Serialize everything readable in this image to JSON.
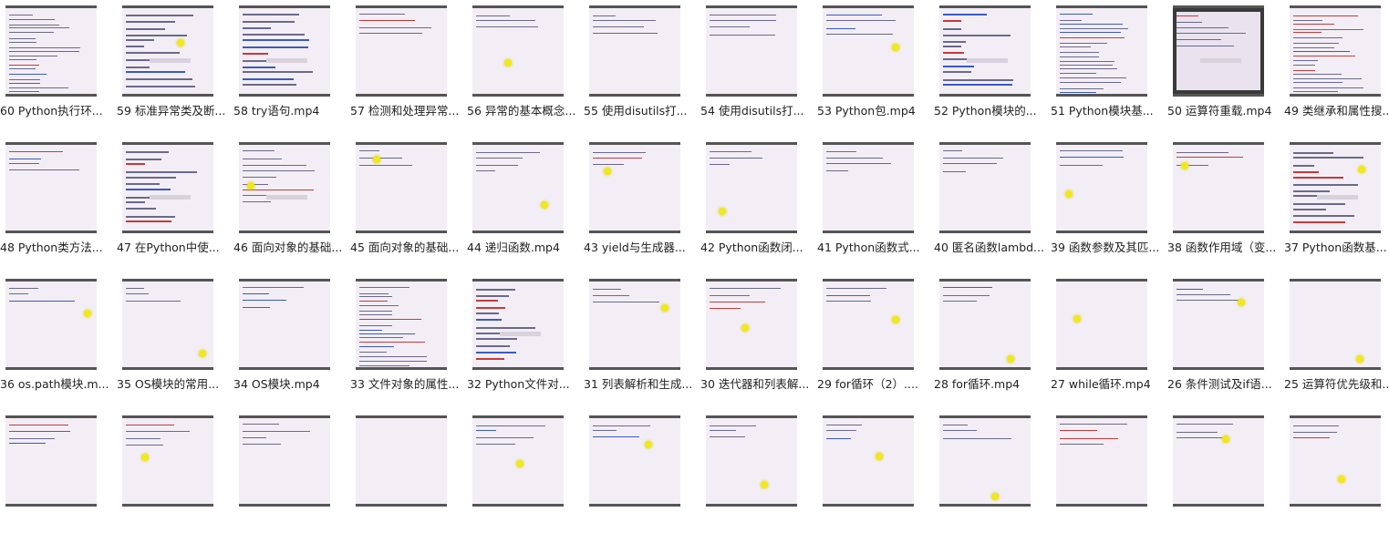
{
  "files": [
    {
      "name": "60 Python执行环...",
      "style": "dense"
    },
    {
      "name": "59 标准异常类及断...",
      "style": "textbook"
    },
    {
      "name": "58 try语句.mp4",
      "style": "textbook"
    },
    {
      "name": "57 检测和处理异常...",
      "style": "sparse"
    },
    {
      "name": "56 异常的基本概念...",
      "style": "cursor"
    },
    {
      "name": "55 使用disutils打...",
      "style": "sparse"
    },
    {
      "name": "54 使用disutils打...",
      "style": "sparse"
    },
    {
      "name": "53 Python包.mp4",
      "style": "sparse"
    },
    {
      "name": "52 Python模块的...",
      "style": "textbook"
    },
    {
      "name": "51 Python模块基...",
      "style": "dense"
    },
    {
      "name": "50 运算符重载.mp4",
      "style": "dark"
    },
    {
      "name": "49 类继承和属性搜...",
      "style": "dense"
    },
    {
      "name": "48 Python类方法...",
      "style": "sparse"
    },
    {
      "name": "47 在Python中使...",
      "style": "textbook"
    },
    {
      "name": "46 面向对象的基础...",
      "style": "dialog"
    },
    {
      "name": "45 面向对象的基础...",
      "style": "cursor"
    },
    {
      "name": "44 递归函数.mp4",
      "style": "sparse"
    },
    {
      "name": "43 yield与生成器...",
      "style": "cursor"
    },
    {
      "name": "42 Python函数闭...",
      "style": "cursor"
    },
    {
      "name": "41 Python函数式...",
      "style": "sparse"
    },
    {
      "name": "40 匿名函数lambd...",
      "style": "sparse"
    },
    {
      "name": "39 函数参数及其匹...",
      "style": "cursor"
    },
    {
      "name": "38 函数作用域（变...",
      "style": "cursor"
    },
    {
      "name": "37 Python函数基...",
      "style": "textbook"
    },
    {
      "name": "36 os.path模块.m...",
      "style": "cursor"
    },
    {
      "name": "35 OS模块的常用...",
      "style": "cursor"
    },
    {
      "name": "34 OS模块.mp4",
      "style": "sparse"
    },
    {
      "name": "33 文件对象的属性...",
      "style": "dense"
    },
    {
      "name": "32 Python文件对...",
      "style": "textbook"
    },
    {
      "name": "31 列表解析和生成...",
      "style": "cursor"
    },
    {
      "name": "30 迭代器和列表解...",
      "style": "sparse"
    },
    {
      "name": "29 for循环（2）....",
      "style": "cursor"
    },
    {
      "name": "28 for循环.mp4",
      "style": "cursor"
    },
    {
      "name": "27 while循环.mp4",
      "style": "blank"
    },
    {
      "name": "26 条件测试及if语...",
      "style": "cursor"
    },
    {
      "name": "25 运算符优先级和...",
      "style": "blank"
    },
    {
      "name": "",
      "style": "sparse"
    },
    {
      "name": "",
      "style": "sparse"
    },
    {
      "name": "",
      "style": "sparse"
    },
    {
      "name": "",
      "style": "blank"
    },
    {
      "name": "",
      "style": "sparse"
    },
    {
      "name": "",
      "style": "cursor"
    },
    {
      "name": "",
      "style": "cursor"
    },
    {
      "name": "",
      "style": "cursor"
    },
    {
      "name": "",
      "style": "cursor"
    },
    {
      "name": "",
      "style": "sparse"
    },
    {
      "name": "",
      "style": "cursor"
    },
    {
      "name": "",
      "style": "cursor"
    }
  ]
}
